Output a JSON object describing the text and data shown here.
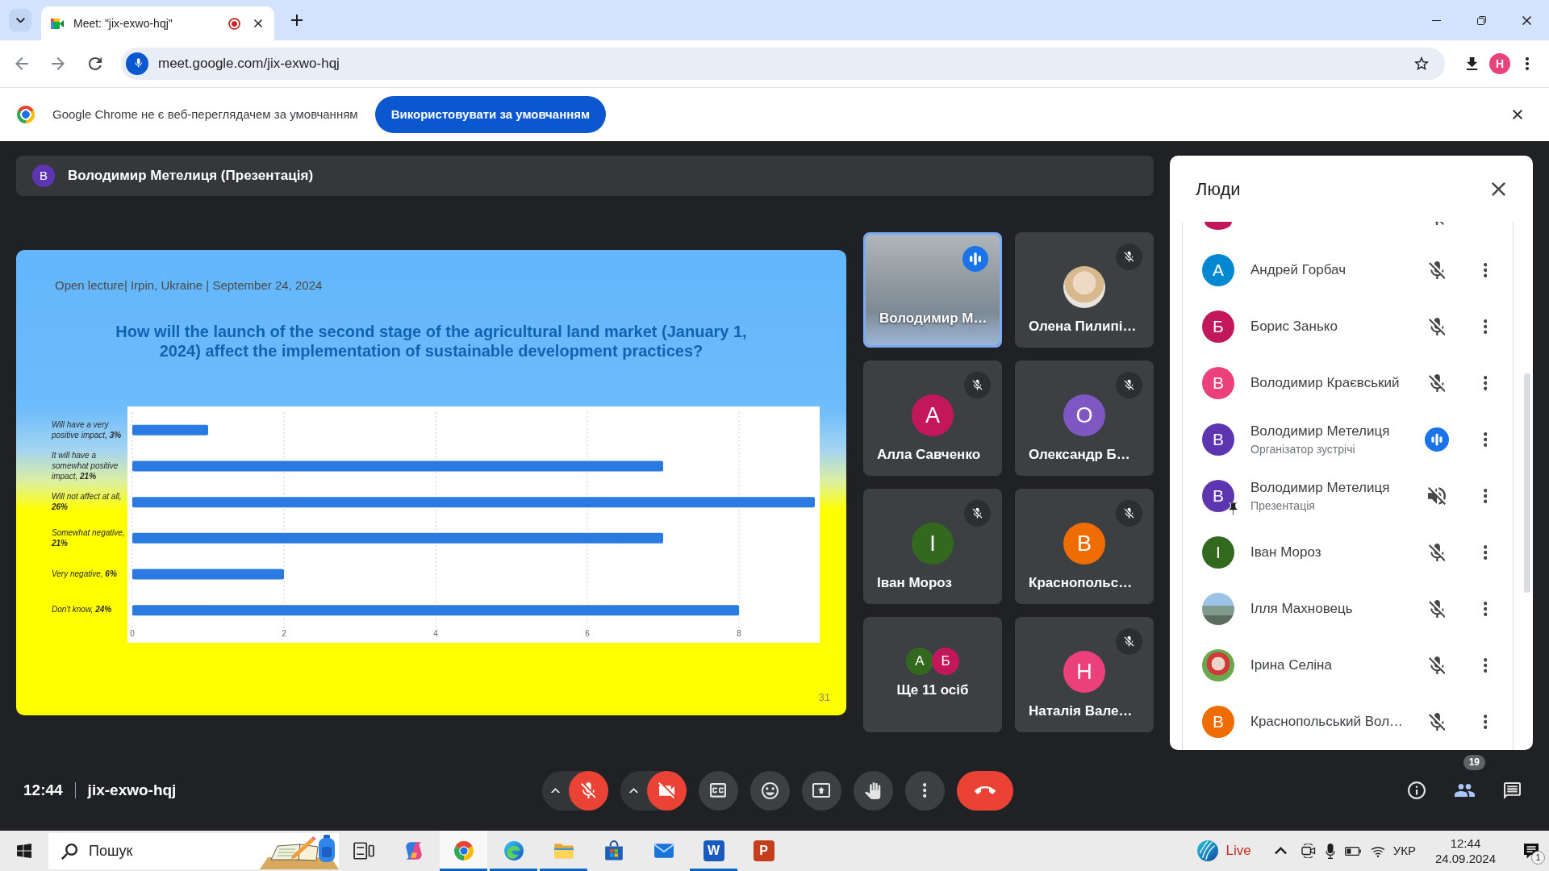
{
  "browser": {
    "tab": {
      "title": "Meet: \"jix-exwo-hqj\"",
      "recording": true
    },
    "address": "meet.google.com/jix-exwo-hqj",
    "profile_initial": "Н"
  },
  "infobar": {
    "message": "Google Chrome не є веб-переглядачем за умовчанням",
    "button": "Використовувати за умовчанням"
  },
  "presenter_bar": {
    "initial": "В",
    "title": "Володимир Метелиця (Презентація)"
  },
  "slide": {
    "caption": "Open lecture| Irpin, Ukraine | September 24, 2024",
    "title": "How will the launch of the second stage of the agricultural land market (January 1, 2024) affect the implementation of sustainable development practices?",
    "page_number": "31",
    "chart_data": {
      "type": "bar",
      "orientation": "horizontal",
      "categories": [
        "Will have a very positive impact, **3%**",
        "It will have a somewhat positive impact, **21%**",
        "Will not affect at all, **26%**",
        "Somewhat negative, **21%**",
        "Very negative, **6%**",
        "Don't know, **24%**"
      ],
      "values": [
        1,
        7,
        9,
        7,
        2,
        8
      ],
      "xlim": [
        0,
        9
      ],
      "xticks": [
        0,
        2,
        4,
        6,
        8
      ],
      "grid": true
    }
  },
  "tiles": [
    {
      "kind": "video",
      "name": "Володимир М…",
      "muted": false,
      "speaking": true
    },
    {
      "kind": "photo",
      "name": "Олена Пилипі…",
      "muted": true,
      "speaking": false
    },
    {
      "kind": "initial",
      "initial": "А",
      "color": "#c2185b",
      "name": "Алла Савченко",
      "muted": true,
      "speaking": false
    },
    {
      "kind": "initial",
      "initial": "О",
      "color": "#7e57c2",
      "name": "Олександр Б…",
      "muted": true,
      "speaking": false
    },
    {
      "kind": "initial",
      "initial": "І",
      "color": "#33691e",
      "name": "Іван Мороз",
      "muted": true,
      "speaking": false
    },
    {
      "kind": "initial",
      "initial": "В",
      "color": "#ef6c00",
      "name": "Краснопольс…",
      "muted": true,
      "speaking": false
    },
    {
      "kind": "more",
      "avatars": [
        {
          "initial": "А",
          "color": "#33691e"
        },
        {
          "initial": "Б",
          "color": "#c2185b"
        }
      ],
      "name": "Ще 11 осіб",
      "muted": false,
      "speaking": false
    },
    {
      "kind": "initial",
      "initial": "Н",
      "color": "#ec407a",
      "name": "Наталія Вале…",
      "muted": true,
      "speaking": false
    }
  ],
  "people_panel": {
    "title": "Люди",
    "people": [
      {
        "kind": "partial",
        "color": "#c2185b"
      },
      {
        "kind": "initial",
        "initial": "А",
        "color": "#0288d1",
        "name": "Андрей Горбач",
        "muted": true,
        "speaking": false,
        "pinned": false
      },
      {
        "kind": "initial",
        "initial": "Б",
        "color": "#c2185b",
        "name": "Борис Занько",
        "muted": true,
        "speaking": false,
        "pinned": false
      },
      {
        "kind": "initial",
        "initial": "В",
        "color": "#ec407a",
        "name": "Володимир Краєвський",
        "muted": true,
        "speaking": false,
        "pinned": false
      },
      {
        "kind": "initial",
        "initial": "В",
        "color": "#5e35b1",
        "name": "Володимир Метелиця",
        "role": "Організатор зустрічі",
        "muted": false,
        "speaking": true,
        "pinned": false
      },
      {
        "kind": "presentation",
        "initial": "В",
        "color": "#5e35b1",
        "name": "Володимир Метелиця",
        "role": "Презентація",
        "muted": true,
        "speaking": false,
        "pinned": true
      },
      {
        "kind": "initial",
        "initial": "І",
        "color": "#33691e",
        "name": "Іван Мороз",
        "muted": true,
        "speaking": false,
        "pinned": false
      },
      {
        "kind": "photo",
        "name": "Ілля Махновець",
        "muted": true,
        "speaking": false,
        "pinned": false
      },
      {
        "kind": "photo",
        "name": "Ірина Селіна",
        "muted": true,
        "speaking": false,
        "pinned": false
      },
      {
        "kind": "initial",
        "initial": "В",
        "color": "#ef6c00",
        "name": "Краснопольський Вол…",
        "muted": true,
        "speaking": false,
        "pinned": false
      }
    ]
  },
  "meeting_bar": {
    "time": "12:44",
    "code": "jix-exwo-hqj",
    "controls": [
      {
        "kind": "mic",
        "on": false
      },
      {
        "kind": "camera",
        "on": false
      },
      {
        "kind": "captions"
      },
      {
        "kind": "reactions"
      },
      {
        "kind": "present"
      },
      {
        "kind": "raise_hand"
      },
      {
        "kind": "more"
      },
      {
        "kind": "leave"
      }
    ],
    "side": [
      {
        "kind": "info",
        "selected": false
      },
      {
        "kind": "people",
        "selected": true,
        "badge": "19"
      },
      {
        "kind": "chat",
        "selected": false
      }
    ]
  },
  "taskbar": {
    "search_placeholder": "Пошук",
    "apps": [
      {
        "kind": "task_view",
        "selected": false,
        "running": false
      },
      {
        "kind": "copilot",
        "selected": false,
        "running": false
      },
      {
        "kind": "chrome",
        "selected": true,
        "running": true
      },
      {
        "kind": "edge",
        "selected": false,
        "running": true
      },
      {
        "kind": "files",
        "selected": false,
        "running": true
      },
      {
        "kind": "store",
        "selected": false,
        "running": false
      },
      {
        "kind": "mail",
        "selected": false,
        "running": false
      },
      {
        "kind": "word",
        "letter": "W",
        "selected": false,
        "running": true
      },
      {
        "kind": "powerpoint",
        "letter": "P",
        "selected": false,
        "running": false
      }
    ],
    "weather": "Live",
    "language": "УКР",
    "time": "12:44",
    "date": "24.09.2024",
    "notifications": "1"
  }
}
